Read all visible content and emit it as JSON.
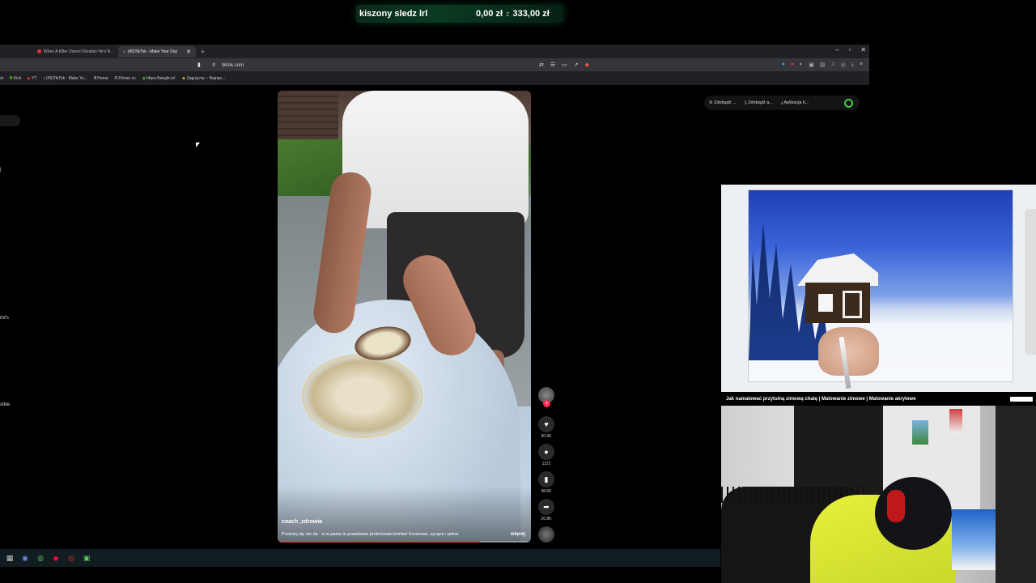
{
  "goal": {
    "title": "kiszony sledz lrl",
    "current": "0,00 zł",
    "separator": "z",
    "target": "333,00 zł",
    "accent": "#0b3a22"
  },
  "browser": {
    "tabs": [
      {
        "label": "When A Killer Doesn't Realize He's B...",
        "active": false
      },
      {
        "label": "(45)TikTok - Make Your Day",
        "active": true
      }
    ],
    "new_tab": "+",
    "window_controls": [
      "–",
      "▫",
      "✕"
    ],
    "url": "tiktok.com",
    "bookmarks": [
      "Kick",
      "YT",
      "(45)TikTok - Make Yo...",
      "Home",
      "Filman.cc",
      "https://tangle.io/",
      "Zagraj.my – Najnps..."
    ]
  },
  "sidebar": {
    "snippet1": "rld's",
    "snippet2": "stkie"
  },
  "video": {
    "author": "coach_zdrowia",
    "description": "Prościej się nie da - a ta pasta to prawdziwa proteinowa bomba! Kromowa, sycąca i pełna",
    "more_label": "więcej",
    "progress": 0.8
  },
  "actions": {
    "likes": "90.9K",
    "comments": "1122",
    "saves": "48.6K",
    "shares": "26.8K"
  },
  "top_right": {
    "items": [
      "Zdobądź ...",
      "Zdobądź a...",
      "Aplikacja k..."
    ]
  },
  "overlay": {
    "caption": "Jak namalować przytulną zimową chatę | Malowanie zimowe | Malowanie akrylowe"
  }
}
